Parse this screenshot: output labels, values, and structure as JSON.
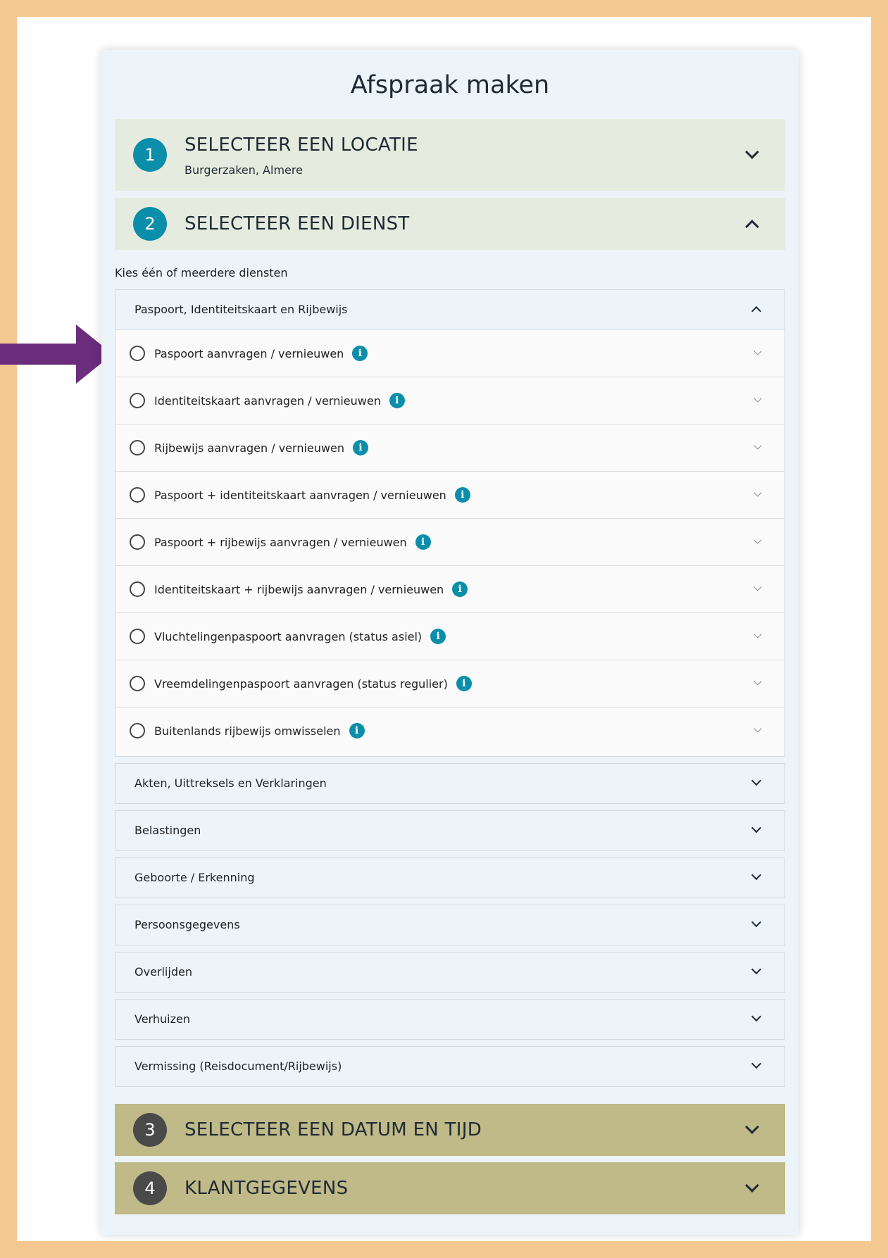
{
  "page": {
    "title": "Afspraak maken"
  },
  "steps": [
    {
      "num": "1",
      "title": "SELECTEER EEN LOCATIE",
      "subtitle": "Burgerzaken, Almere",
      "state": "collapsed"
    },
    {
      "num": "2",
      "title": "SELECTEER EEN DIENST",
      "state": "expanded"
    },
    {
      "num": "3",
      "title": "SELECTEER EEN DATUM EN TIJD",
      "state": "collapsed"
    },
    {
      "num": "4",
      "title": "KLANTGEGEVENS",
      "state": "collapsed"
    }
  ],
  "services": {
    "hint": "Kies één of meerdere diensten",
    "open_group": {
      "label": "Paspoort, Identiteitskaart en Rijbewijs",
      "items": [
        {
          "label": "Paspoort aanvragen / vernieuwen",
          "selected": false
        },
        {
          "label": "Identiteitskaart aanvragen / vernieuwen",
          "selected": false
        },
        {
          "label": "Rijbewijs aanvragen / vernieuwen",
          "selected": false
        },
        {
          "label": "Paspoort + identiteitskaart aanvragen / vernieuwen",
          "selected": false
        },
        {
          "label": "Paspoort + rijbewijs aanvragen / vernieuwen",
          "selected": false
        },
        {
          "label": "Identiteitskaart + rijbewijs aanvragen / vernieuwen",
          "selected": false
        },
        {
          "label": "Vluchtelingenpaspoort aanvragen (status asiel)",
          "selected": false
        },
        {
          "label": "Vreemdelingenpaspoort aanvragen (status regulier)",
          "selected": false
        },
        {
          "label": "Buitenlands rijbewijs omwisselen",
          "selected": false
        }
      ]
    },
    "closed_groups": [
      {
        "label": "Akten, Uittreksels en Verklaringen"
      },
      {
        "label": "Belastingen"
      },
      {
        "label": "Geboorte / Erkenning"
      },
      {
        "label": "Persoonsgegevens"
      },
      {
        "label": "Overlijden"
      },
      {
        "label": "Verhuizen"
      },
      {
        "label": "Vermissing (Reisdocument/Rijbewijs)"
      }
    ]
  },
  "icons": {
    "info": "i",
    "info_icon_name": "info-icon",
    "annotation_arrow": "arrow-right-icon"
  },
  "colors": {
    "frame": "#f5c891",
    "card": "#ecf4fa",
    "step_active": "#e5ecdf",
    "step_inactive": "#c0b988",
    "accent": "#0b8eaa",
    "arrow": "#6b2d7b"
  }
}
